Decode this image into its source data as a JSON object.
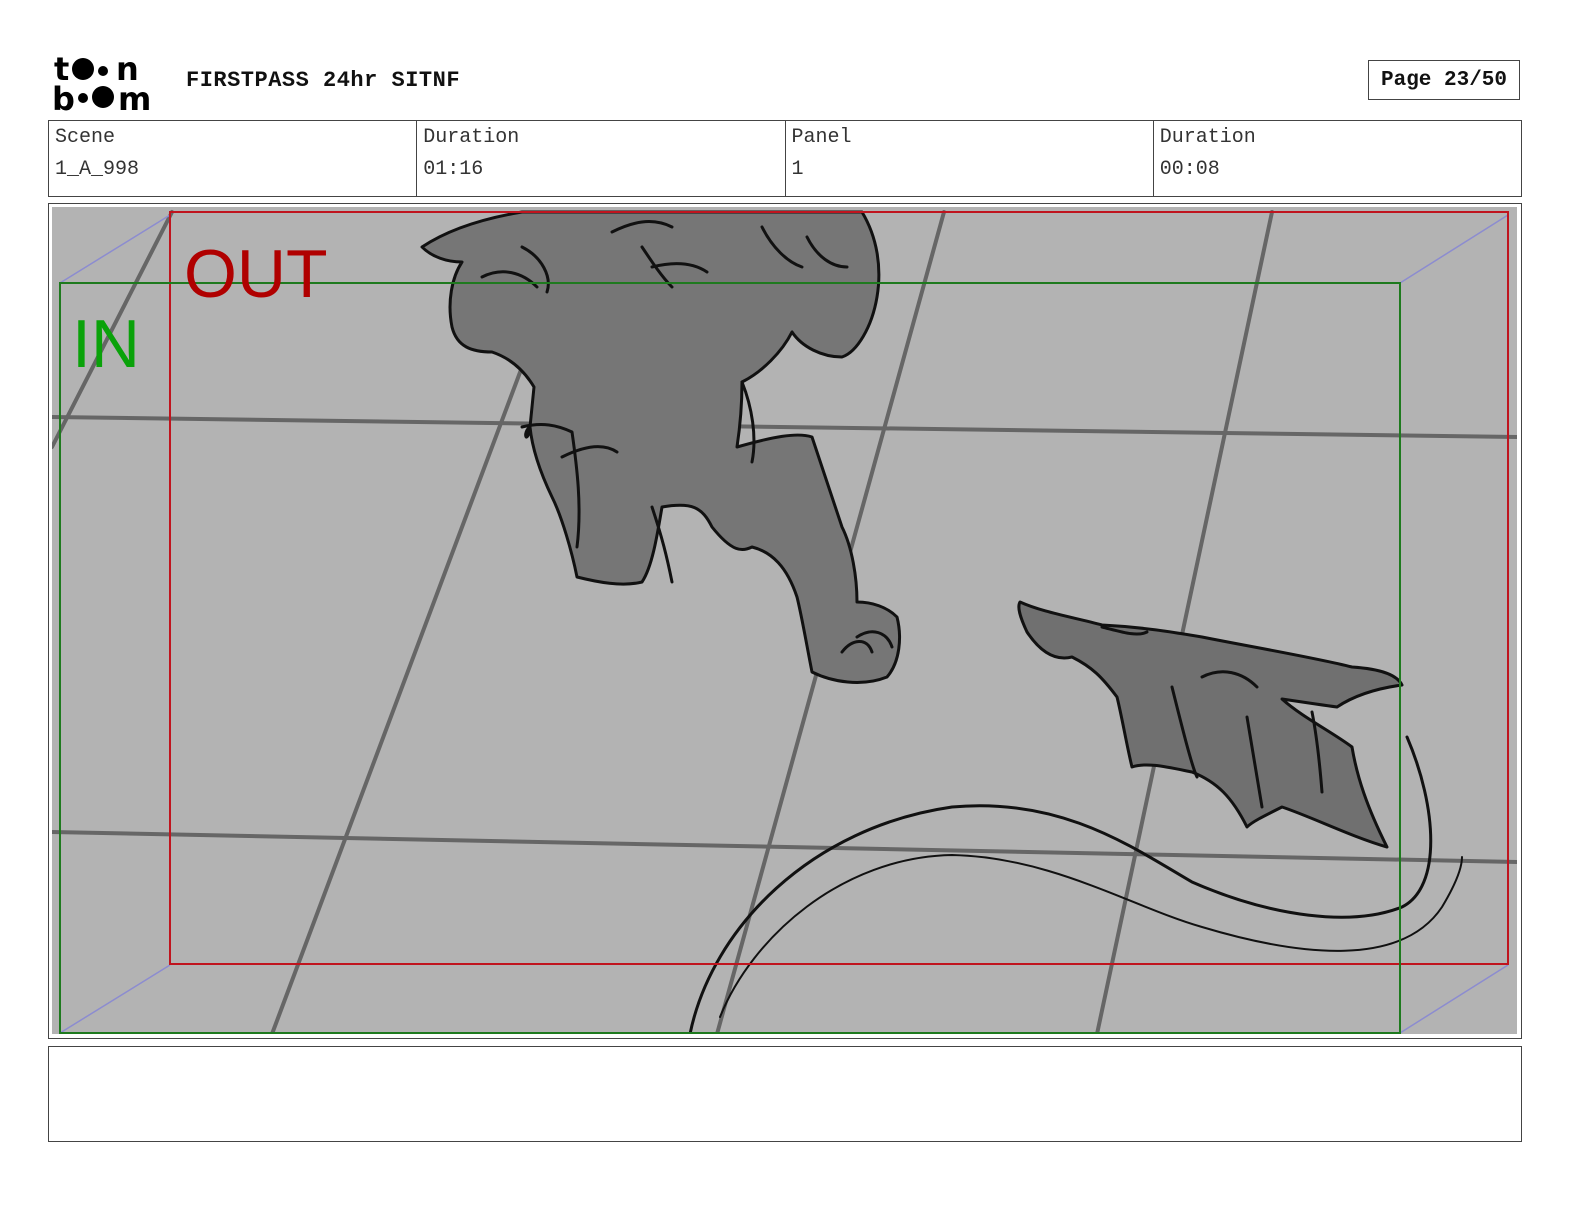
{
  "header": {
    "logo_name": "toon-boom-logo",
    "title": "FIRSTPASS 24hr SITNF",
    "page_label": "Page 23/50"
  },
  "info": {
    "scene_label": "Scene",
    "scene_value": "1_A_998",
    "scene_duration_label": "Duration",
    "scene_duration_value": "01:16",
    "panel_label": "Panel",
    "panel_value": "1",
    "panel_duration_label": "Duration",
    "panel_duration_value": "00:08"
  },
  "panel": {
    "out_label": "OUT",
    "in_label": "IN",
    "colors": {
      "background": "#b3b3b3",
      "out_frame": "#c0141e",
      "in_frame": "#1e7a1e",
      "in_text": "#0aa20a",
      "out_text": "#b00000",
      "fill": "#767676",
      "guide": "#8c8cd0"
    }
  },
  "notes": {
    "text": ""
  }
}
